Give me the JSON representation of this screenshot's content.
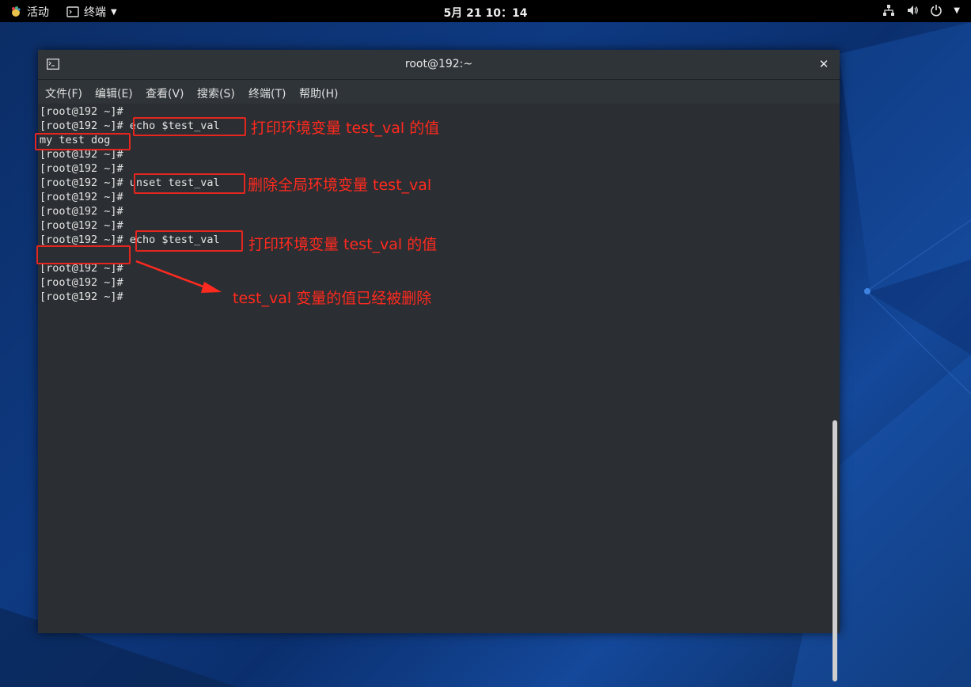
{
  "topbar": {
    "activities": "活动",
    "app_name": "终端",
    "clock": "5月 21  10：14"
  },
  "window": {
    "title": "root@192:~",
    "close": "✕"
  },
  "menu": [
    {
      "label": "文件(F)"
    },
    {
      "label": "编辑(E)"
    },
    {
      "label": "查看(V)"
    },
    {
      "label": "搜索(S)"
    },
    {
      "label": "终端(T)"
    },
    {
      "label": "帮助(H)"
    }
  ],
  "terminal": {
    "lines": [
      "[root@192 ~]#",
      "[root@192 ~]# echo $test_val",
      "my test dog",
      "[root@192 ~]#",
      "[root@192 ~]#",
      "[root@192 ~]# unset test_val",
      "[root@192 ~]#",
      "[root@192 ~]#",
      "[root@192 ~]#",
      "[root@192 ~]# echo $test_val",
      "",
      "[root@192 ~]#",
      "[root@192 ~]#",
      "[root@192 ~]#"
    ]
  },
  "annotations": {
    "note1": "打印环境变量 test_val 的值",
    "note2": "删除全局环境变量 test_val",
    "note3": "打印环境变量 test_val 的值",
    "note4": "test_val 变量的值已经被删除",
    "color": "#e5261f"
  }
}
